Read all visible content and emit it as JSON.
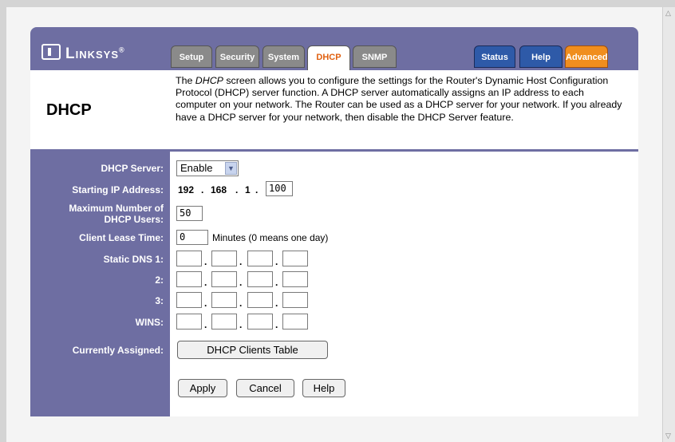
{
  "brand": {
    "name": "Linksys"
  },
  "tabs": {
    "left": [
      {
        "label": "Setup"
      },
      {
        "label": "Security"
      },
      {
        "label": "System"
      },
      {
        "label": "DHCP"
      },
      {
        "label": "SNMP"
      }
    ],
    "right": [
      {
        "label": "Status"
      },
      {
        "label": "Help"
      },
      {
        "label": "Advanced"
      }
    ],
    "selected": "DHCP"
  },
  "header": {
    "title": "DHCP",
    "description_pre": "The ",
    "description_em": "DHCP",
    "description_post": " screen allows you to configure the settings for the Router's Dynamic Host Configuration Protocol (DHCP) server function. A DHCP server automatically assigns an IP address to each computer on your network. The Router can be used as a DHCP server for your network. If you already have a DHCP server for your network, then disable the DHCP Server feature."
  },
  "form": {
    "dhcp_server": {
      "label": "DHCP Server:",
      "value": "Enable"
    },
    "starting_ip": {
      "label": "Starting IP Address:",
      "octet1": "192",
      "octet2": "168",
      "octet3": "1",
      "octet4": "100"
    },
    "max_users": {
      "label_line1": "Maximum Number of",
      "label_line2": "DHCP Users:",
      "value": "50"
    },
    "lease_time": {
      "label": "Client Lease Time:",
      "value": "0",
      "suffix": "Minutes (0 means one day)"
    },
    "dns1": {
      "label": "Static DNS 1:"
    },
    "dns2": {
      "label": "2:"
    },
    "dns3": {
      "label": "3:"
    },
    "wins": {
      "label": "WINS:"
    },
    "assigned": {
      "label": "Currently Assigned:",
      "button": "DHCP Clients Table"
    }
  },
  "actions": {
    "apply": "Apply",
    "cancel": "Cancel",
    "help": "Help"
  },
  "colors": {
    "panel": "#6e6ea2",
    "selected_tab_text": "#e06010",
    "blue_tab": "#2e5aa8",
    "orange_tab": "#f08e1e"
  }
}
